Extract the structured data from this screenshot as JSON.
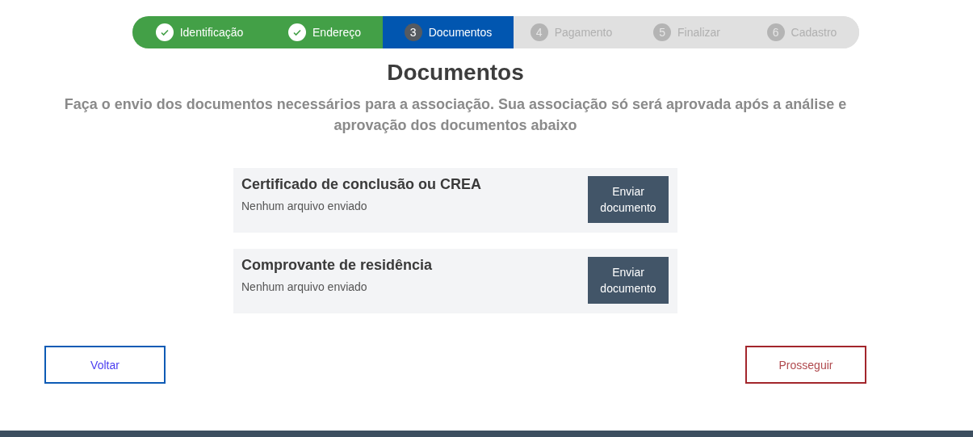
{
  "steps": [
    {
      "label": "Identificação",
      "kind": "done"
    },
    {
      "label": "Endereço",
      "kind": "done"
    },
    {
      "number": "3",
      "label": "Documentos",
      "kind": "current"
    },
    {
      "number": "4",
      "label": "Pagamento",
      "kind": "pending"
    },
    {
      "number": "5",
      "label": "Finalizar",
      "kind": "pending"
    },
    {
      "number": "6",
      "label": "Cadastro",
      "kind": "pending"
    }
  ],
  "title": "Documentos",
  "subtitle": "Faça o envio dos documentos necessários para a associação. Sua associação só será aprovada após a análise e aprovação dos documentos abaixo",
  "documents": [
    {
      "name": "Certificado de conclusão ou CREA",
      "status": "Nenhum arquivo enviado",
      "button": "Enviar documento"
    },
    {
      "name": "Comprovante de residência",
      "status": "Nenhum arquivo enviado",
      "button": "Enviar documento"
    }
  ],
  "back_button": "Voltar",
  "next_button": "Prosseguir"
}
